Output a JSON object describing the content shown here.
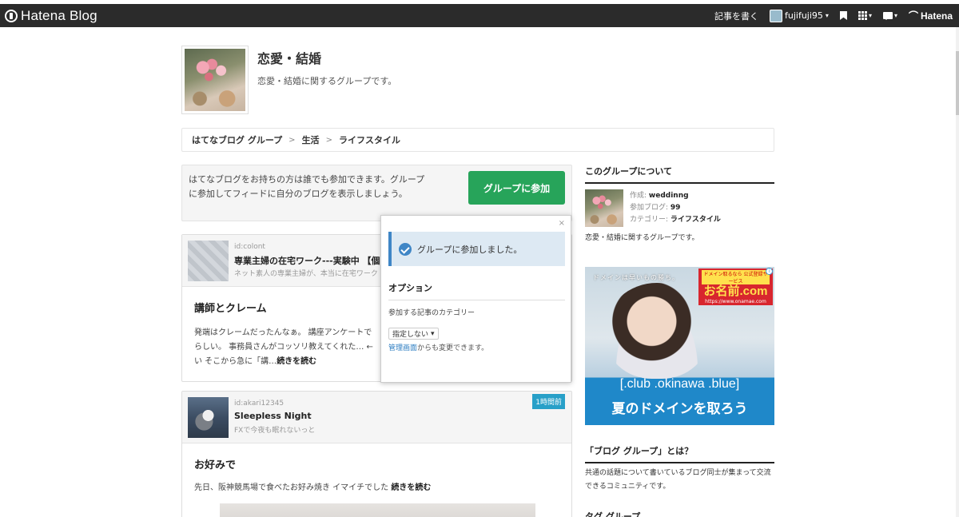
{
  "header": {
    "logo_text": "Hatena Blog",
    "write_label": "記事を書く",
    "username": "fujifuji95",
    "brand": "Hatena"
  },
  "group": {
    "title": "恋愛・結婚",
    "description": "恋愛・結婚に関するグループです。"
  },
  "breadcrumb": {
    "items": [
      "はてなブログ グループ",
      "生活",
      "ライフスタイル"
    ],
    "separator": ">"
  },
  "join_box": {
    "text": "はてなブログをお持ちの方は誰でも参加できます。グループに参加してフィードに自分のブログを表示しましょう。",
    "button_label": "グループに参加"
  },
  "entries": [
    {
      "id": "id:colont",
      "blog_title": "専業主婦の在宅ワーク---実験中 【個",
      "blog_desc": "ネット素人の専業主婦が、本当に在宅ワーク",
      "title": "講師とクレーム",
      "summary": "発端はクレームだったんなぁ。 講座アンケートで らしい。 事務員さんがコッソリ教えてくれた… ←い そこから急に「講…",
      "read_more": "続きを読む"
    },
    {
      "id": "id:akari12345",
      "blog_title": "Sleepless Night",
      "blog_desc": "FXで今夜も眠れないっと",
      "badge": "1時間前",
      "title": "お好みで",
      "summary": "先日、阪神競馬場で食べたお好み焼き イマイチでした ",
      "read_more": "続きを読む"
    }
  ],
  "popup": {
    "close": "×",
    "alert": "グループに参加しました。",
    "heading": "オプション",
    "label": "参加する記事のカテゴリー",
    "select_value": "指定しない",
    "note_link": "管理画面",
    "note_text": "からも変更できます。"
  },
  "sidebar": {
    "about_heading": "このグループについて",
    "creator_label": "作成:",
    "creator": "weddinng",
    "blogs_label": "参加ブログ:",
    "blogs": "99",
    "category_label": "カテゴリー:",
    "category": "ライフスタイル",
    "about_desc": "恋愛・結婚に関するグループです。",
    "ad": {
      "tagline": "ドメインは早いもの勝ち。",
      "brand_top": "ドメイン取るなら 公式登録サービス",
      "brand_name": "お名前.com",
      "brand_url": "https://www.onamae.com",
      "domains": "[.club .okinawa .blue]",
      "headline": "夏のドメインを取ろう"
    },
    "what_heading": "「ブログ グループ」とは？",
    "what_desc": "共通の話題について書いているブログ同士が集まって交流できるコミュニティです。",
    "next_heading": "タグ グループ"
  }
}
